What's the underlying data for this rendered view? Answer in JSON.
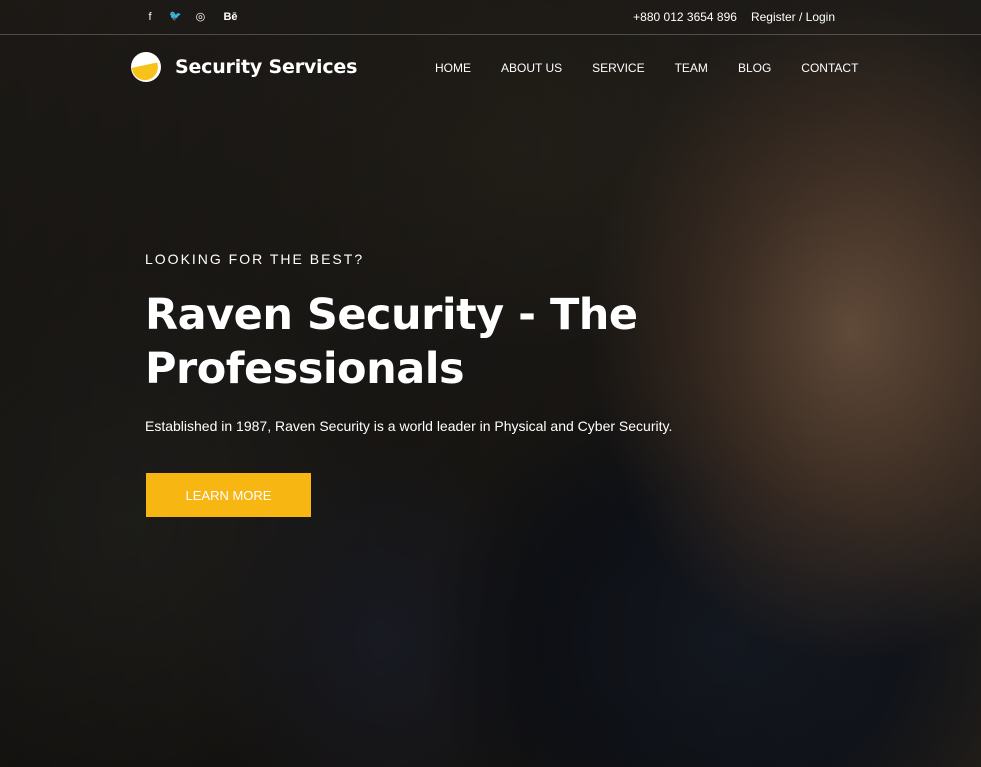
{
  "topbar": {
    "social": [
      {
        "icon": "facebook-icon",
        "glyph": "f"
      },
      {
        "icon": "twitter-icon",
        "glyph": "🐦"
      },
      {
        "icon": "dribbble-icon",
        "glyph": "◎"
      },
      {
        "icon": "behance-icon",
        "glyph": "Bē"
      }
    ],
    "phone": "+880 012 3654 896",
    "auth": "Register / Login"
  },
  "header": {
    "brand": "Security Services",
    "nav": [
      "HOME",
      "ABOUT US",
      "SERVICE",
      "TEAM",
      "BLOG",
      "CONTACT"
    ]
  },
  "hero": {
    "eyebrow": "LOOKING FOR THE BEST?",
    "title": "Raven Security - The Professionals",
    "subtitle": "Established in 1987, Raven Security is a world leader in Physical and Cyber Security.",
    "cta": "LEARN MORE"
  },
  "colors": {
    "accent": "#f7b611",
    "logo_accent": "#f7c31a",
    "text": "#ffffff"
  }
}
